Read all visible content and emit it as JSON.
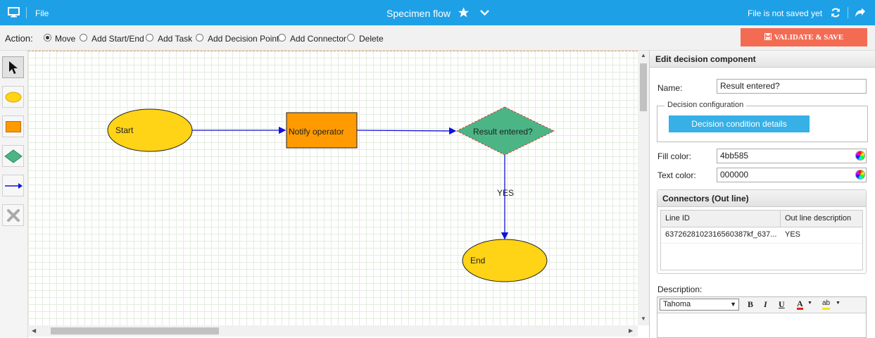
{
  "topbar": {
    "file_menu": "File",
    "title": "Specimen flow",
    "save_status": "File is not saved yet"
  },
  "actions": {
    "label": "Action:",
    "options": [
      "Move",
      "Add Start/End",
      "Add Task",
      "Add Decision Point",
      "Add Connector",
      "Delete"
    ],
    "selected": "Move",
    "validate_save": "VALIDATE & SAVE"
  },
  "tools": [
    "pointer-icon",
    "ellipse-icon",
    "rectangle-icon",
    "diamond-icon",
    "arrow-icon",
    "delete-icon"
  ],
  "diagram": {
    "start": "Start",
    "task": "Notify operator",
    "decision": "Result entered?",
    "end": "End",
    "connector_label": "YES",
    "colors": {
      "start_end": "#ffd316",
      "task": "#ff9a00",
      "decision": "#4bb585",
      "connector": "#1010dd"
    }
  },
  "panel": {
    "title": "Edit decision component",
    "name_label": "Name:",
    "name_value": "Result entered?",
    "decision_config_legend": "Decision configuration",
    "condition_button": "Decision condition details",
    "fill_color_label": "Fill color:",
    "fill_color_value": "4bb585",
    "text_color_label": "Text color:",
    "text_color_value": "000000",
    "connectors_title": "Connectors (Out line)",
    "connectors_columns": [
      "Line ID",
      "Out line description"
    ],
    "connectors_rows": [
      {
        "line_id": "6372628102316560387kf_637...",
        "description": "YES"
      }
    ],
    "description_label": "Description:",
    "editor_font": "Tahoma"
  }
}
